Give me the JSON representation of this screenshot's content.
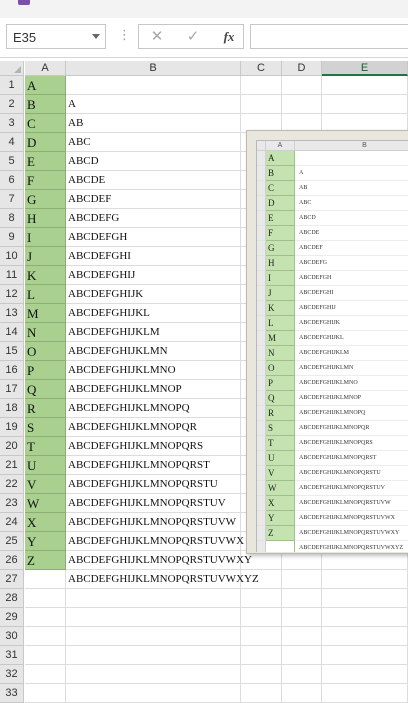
{
  "formula_bar": {
    "namebox_value": "E35",
    "separator": "⋮",
    "cancel_icon": "✕",
    "enter_icon": "✓",
    "fx_label": "fx",
    "formula_value": ""
  },
  "columns": [
    "A",
    "B",
    "C",
    "D",
    "E"
  ],
  "selected_column": "E",
  "rows": [
    {
      "n": "1",
      "a": "A",
      "b": ""
    },
    {
      "n": "2",
      "a": "B",
      "b": "A"
    },
    {
      "n": "3",
      "a": "C",
      "b": "AB"
    },
    {
      "n": "4",
      "a": "D",
      "b": "ABC"
    },
    {
      "n": "5",
      "a": "E",
      "b": "ABCD"
    },
    {
      "n": "6",
      "a": "F",
      "b": "ABCDE"
    },
    {
      "n": "7",
      "a": "G",
      "b": "ABCDEF"
    },
    {
      "n": "8",
      "a": "H",
      "b": "ABCDEFG"
    },
    {
      "n": "9",
      "a": "I",
      "b": "ABCDEFGH"
    },
    {
      "n": "10",
      "a": "J",
      "b": "ABCDEFGHI"
    },
    {
      "n": "11",
      "a": "K",
      "b": "ABCDEFGHIJ"
    },
    {
      "n": "12",
      "a": "L",
      "b": "ABCDEFGHIJK"
    },
    {
      "n": "13",
      "a": "M",
      "b": "ABCDEFGHIJKL"
    },
    {
      "n": "14",
      "a": "N",
      "b": "ABCDEFGHIJKLM"
    },
    {
      "n": "15",
      "a": "O",
      "b": "ABCDEFGHIJKLMN"
    },
    {
      "n": "16",
      "a": "P",
      "b": "ABCDEFGHIJKLMNO"
    },
    {
      "n": "17",
      "a": "Q",
      "b": "ABCDEFGHIJKLMNOP"
    },
    {
      "n": "18",
      "a": "R",
      "b": "ABCDEFGHIJKLMNOPQ"
    },
    {
      "n": "19",
      "a": "S",
      "b": "ABCDEFGHIJKLMNOPQR"
    },
    {
      "n": "20",
      "a": "T",
      "b": "ABCDEFGHIJKLMNOPQRS"
    },
    {
      "n": "21",
      "a": "U",
      "b": "ABCDEFGHIJKLMNOPQRST"
    },
    {
      "n": "22",
      "a": "V",
      "b": "ABCDEFGHIJKLMNOPQRSTU"
    },
    {
      "n": "23",
      "a": "W",
      "b": "ABCDEFGHIJKLMNOPQRSTUV"
    },
    {
      "n": "24",
      "a": "X",
      "b": "ABCDEFGHIJKLMNOPQRSTUVW"
    },
    {
      "n": "25",
      "a": "Y",
      "b": "ABCDEFGHIJKLMNOPQRSTUVWX"
    },
    {
      "n": "26",
      "a": "Z",
      "b": "ABCDEFGHIJKLMNOPQRSTUVWXY"
    },
    {
      "n": "27",
      "a": "",
      "b": "ABCDEFGHIJKLMNOPQRSTUVWXYZ"
    },
    {
      "n": "28",
      "a": "",
      "b": ""
    },
    {
      "n": "29",
      "a": "",
      "b": ""
    },
    {
      "n": "30",
      "a": "",
      "b": ""
    },
    {
      "n": "31",
      "a": "",
      "b": ""
    },
    {
      "n": "32",
      "a": "",
      "b": ""
    },
    {
      "n": "33",
      "a": "",
      "b": ""
    }
  ],
  "picture": {
    "col_a": "A",
    "col_b": "B",
    "rows": [
      {
        "a": "A",
        "b": ""
      },
      {
        "a": "B",
        "b": "A"
      },
      {
        "a": "C",
        "b": "AB"
      },
      {
        "a": "D",
        "b": "ABC"
      },
      {
        "a": "E",
        "b": "ABCD"
      },
      {
        "a": "F",
        "b": "ABCDE"
      },
      {
        "a": "G",
        "b": "ABCDEF"
      },
      {
        "a": "H",
        "b": "ABCDEFG"
      },
      {
        "a": "I",
        "b": "ABCDEFGH"
      },
      {
        "a": "J",
        "b": "ABCDEFGHI"
      },
      {
        "a": "K",
        "b": "ABCDEFGHIJ"
      },
      {
        "a": "L",
        "b": "ABCDEFGHIJK"
      },
      {
        "a": "M",
        "b": "ABCDEFGHIJKL"
      },
      {
        "a": "N",
        "b": "ABCDEFGHIJKLM"
      },
      {
        "a": "O",
        "b": "ABCDEFGHIJKLMN"
      },
      {
        "a": "P",
        "b": "ABCDEFGHIJKLMNO"
      },
      {
        "a": "Q",
        "b": "ABCDEFGHIJKLMNOP"
      },
      {
        "a": "R",
        "b": "ABCDEFGHIJKLMNOPQ"
      },
      {
        "a": "S",
        "b": "ABCDEFGHIJKLMNOPQR"
      },
      {
        "a": "T",
        "b": "ABCDEFGHIJKLMNOPQRS"
      },
      {
        "a": "U",
        "b": "ABCDEFGHIJKLMNOPQRST"
      },
      {
        "a": "V",
        "b": "ABCDEFGHIJKLMNOPQRSTU"
      },
      {
        "a": "W",
        "b": "ABCDEFGHIJKLMNOPQRSTUV"
      },
      {
        "a": "X",
        "b": "ABCDEFGHIJKLMNOPQRSTUVW"
      },
      {
        "a": "Y",
        "b": "ABCDEFGHIJKLMNOPQRSTUVWX"
      },
      {
        "a": "Z",
        "b": "ABCDEFGHIJKLMNOPQRSTUVWXY"
      },
      {
        "a": "",
        "b": "ABCDEFGHIJKLMNOPQRSTUVWXYZ"
      }
    ]
  },
  "colors": {
    "fill_green": "#a9d08e",
    "picture_fill_green": "#c5e3b0",
    "selected_accent": "#217346"
  }
}
